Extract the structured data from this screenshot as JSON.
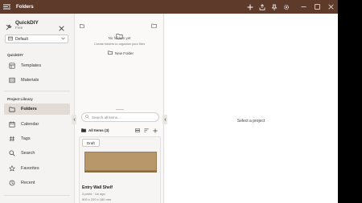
{
  "window": {
    "title": "Folders",
    "accent": "#5e3a2b",
    "actions": [
      "add-icon",
      "export-icon",
      "pin-icon",
      "settings-icon"
    ],
    "controls": [
      "minimize-icon",
      "maximize-icon",
      "close-icon"
    ]
  },
  "sidebar": {
    "app_name": "QuickDIY",
    "plan": "Free",
    "workspace_select": {
      "value": "Default"
    },
    "sections": [
      {
        "label": "QuickDIY",
        "items": [
          {
            "label": "Templates",
            "icon": "templates-icon"
          },
          {
            "label": "Materials",
            "icon": "materials-icon"
          }
        ]
      },
      {
        "label": "Project Library",
        "items": [
          {
            "label": "Folders",
            "icon": "folder-icon",
            "active": true
          },
          {
            "label": "Calendar",
            "icon": "calendar-icon"
          },
          {
            "label": "Tags",
            "icon": "tag-icon"
          },
          {
            "label": "Search",
            "icon": "search-icon"
          },
          {
            "label": "Favorites",
            "icon": "star-icon"
          },
          {
            "label": "Recent",
            "icon": "history-icon"
          }
        ]
      }
    ]
  },
  "folders_panel": {
    "empty_title": "No folders yet",
    "empty_subtitle": "Create folders to organize your files",
    "new_folder_label": "New Folder"
  },
  "items_panel": {
    "search_placeholder": "Search all items...",
    "list_label": "All Items (3)",
    "cards": [
      {
        "badge": "Draft",
        "title": "Entry Wall Shelf",
        "meta": "4 parts · 1w ago",
        "dims": "900 x 220 x 180 mm"
      }
    ]
  },
  "detail": {
    "empty_text": "Select a project"
  }
}
